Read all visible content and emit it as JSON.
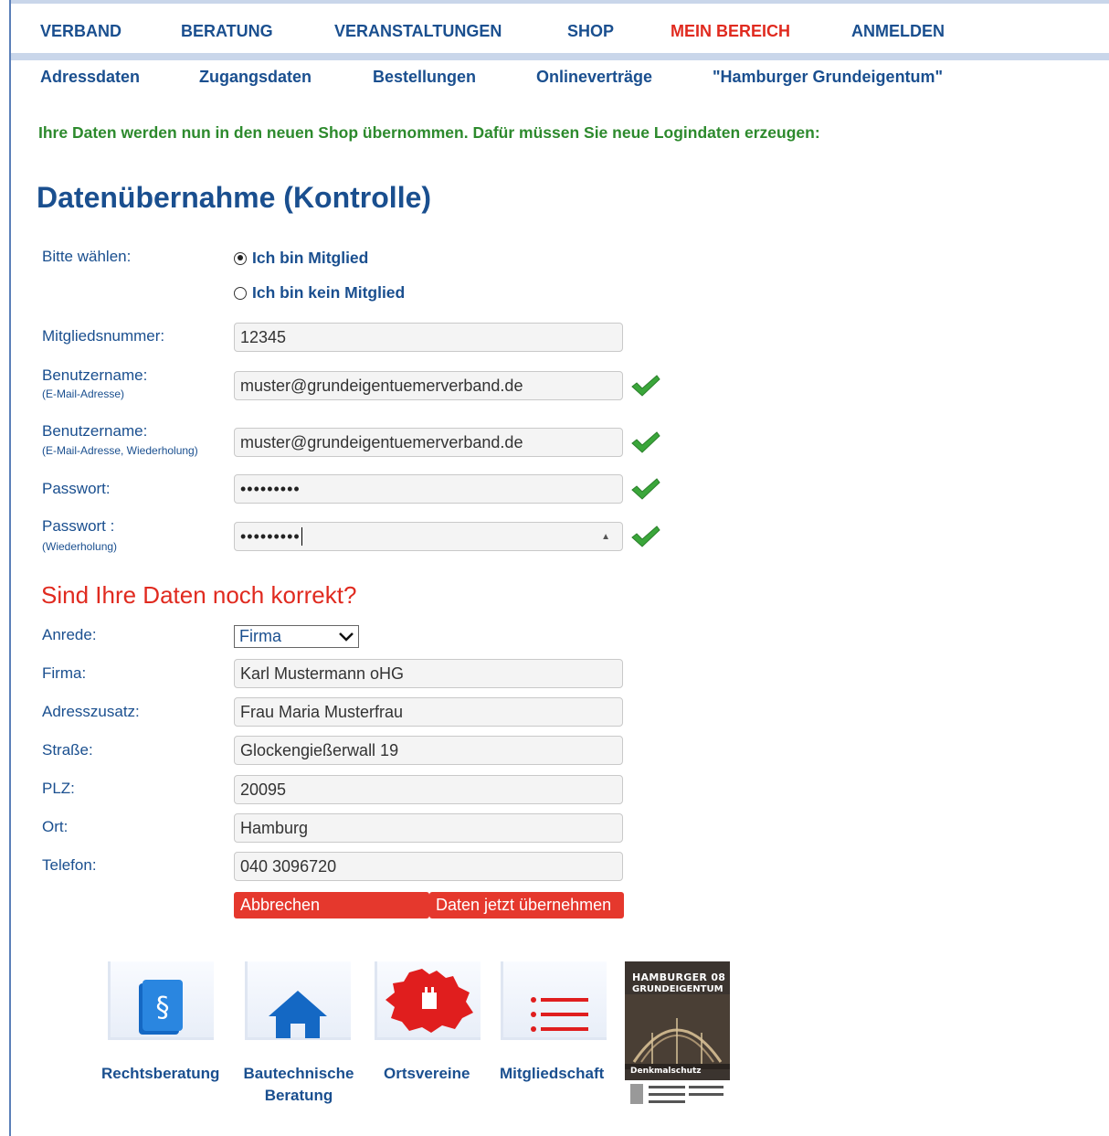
{
  "nav": {
    "items": [
      {
        "label": "VERBAND"
      },
      {
        "label": "BERATUNG"
      },
      {
        "label": "VERANSTALTUNGEN"
      },
      {
        "label": "SHOP"
      },
      {
        "label": "MEIN BEREICH",
        "active": true
      },
      {
        "label": "ANMELDEN"
      }
    ]
  },
  "subnav": {
    "items": [
      {
        "label": "Adressdaten"
      },
      {
        "label": "Zugangsdaten"
      },
      {
        "label": "Bestellungen"
      },
      {
        "label": "Onlineverträge"
      },
      {
        "label": "\"Hamburger Grundeigentum\""
      }
    ]
  },
  "notice": "Ihre Daten werden nun in den neuen Shop übernommen. Dafür müssen Sie neue Logindaten erzeugen:",
  "page_title": "Datenübernahme (Kontrolle)",
  "membership": {
    "label": "Bitte wählen:",
    "options": [
      {
        "label": "Ich bin Mitglied",
        "checked": true
      },
      {
        "label": "Ich bin kein Mitglied",
        "checked": false
      }
    ]
  },
  "login": {
    "member_number": {
      "label": "Mitgliedsnummer:",
      "value": "12345"
    },
    "username": {
      "label": "Benutzername:",
      "sublabel": "(E-Mail-Adresse)",
      "value": "muster@grundeigentuemerverband.de"
    },
    "username_repeat": {
      "label": "Benutzername:",
      "sublabel": "(E-Mail-Adresse, Wiederholung)",
      "value": "muster@grundeigentuemerverband.de"
    },
    "password": {
      "label": "Passwort:",
      "value": "•••••••••"
    },
    "password_repeat": {
      "label": "Passwort :",
      "sublabel": "(Wiederholung)",
      "value": "•••••••••"
    }
  },
  "section_title": "Sind Ihre Daten noch korrekt?",
  "address": {
    "salutation": {
      "label": "Anrede:",
      "value": "Firma"
    },
    "company": {
      "label": "Firma:",
      "value": "Karl Mustermann oHG"
    },
    "address_extra": {
      "label": "Adresszusatz:",
      "value": "Frau Maria Musterfrau"
    },
    "street": {
      "label": "Straße:",
      "value": "Glockengießerwall 19"
    },
    "zip": {
      "label": "PLZ:",
      "value": "20095"
    },
    "city": {
      "label": "Ort:",
      "value": "Hamburg"
    },
    "phone": {
      "label": "Telefon:",
      "value": "040 3096720"
    }
  },
  "buttons": {
    "cancel": "Abbrechen",
    "submit": "Daten jetzt übernehmen"
  },
  "tiles": [
    {
      "label": "Rechtsberatung",
      "icon": "paragraph-book-icon"
    },
    {
      "label": "Bautechnische",
      "label2": "Beratung",
      "icon": "house-icon"
    },
    {
      "label": "Ortsvereine",
      "icon": "hamburg-map-icon"
    },
    {
      "label": "Mitgliedschaft",
      "icon": "list-icon"
    }
  ],
  "magazine": {
    "title_line1": "HAMBURGER",
    "issue": "08",
    "title_line2": "GRUNDEIGENTUM",
    "subtitle": "Denkmalschutz"
  },
  "colors": {
    "brand_blue": "#1a4f8f",
    "accent_red": "#e02a1f",
    "notice_green": "#2d8a2d",
    "check_green": "#3aa63a"
  }
}
